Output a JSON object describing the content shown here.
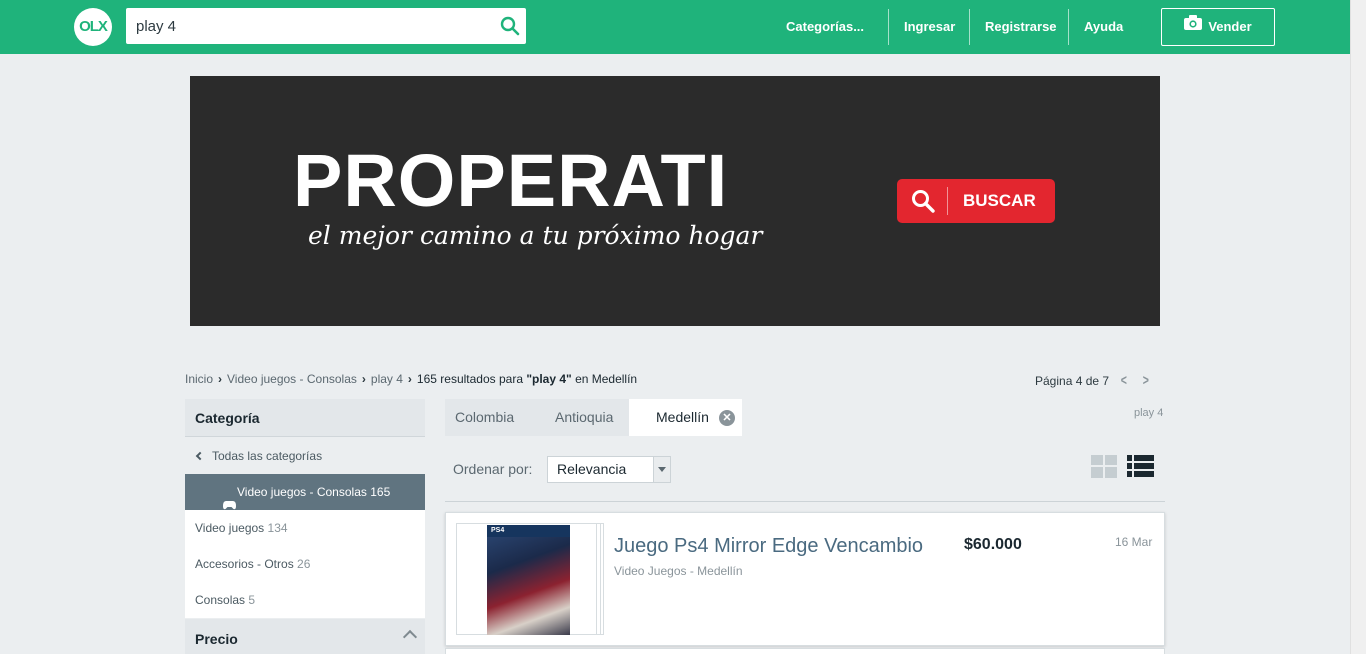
{
  "header": {
    "logo": "OLX",
    "search_value": "play 4",
    "nav": {
      "categories": "Categorías...",
      "login": "Ingresar",
      "register": "Registrarse",
      "help": "Ayuda",
      "sell": "Vender"
    },
    "brand_color": "#1fb37b"
  },
  "banner": {
    "title": "PROPERATI",
    "subtitle": "el mejor camino a tu próximo hogar",
    "button": "BUSCAR",
    "button_color": "#e3262f"
  },
  "breadcrumb": {
    "home": "Inicio",
    "category": "Video juegos - Consolas",
    "query": "play 4",
    "results_prefix": "165 resultados para ",
    "results_query": "\"play 4\"",
    "results_suffix": " en Medellín"
  },
  "pagination": {
    "text": "Página 4 de 7"
  },
  "sidebar": {
    "category_heading": "Categoría",
    "all_categories": "Todas las categorías",
    "active": {
      "label": "Video juegos - Consolas",
      "count": "165"
    },
    "items": [
      {
        "label": "Video juegos",
        "count": "134"
      },
      {
        "label": "Accesorios - Otros",
        "count": "26"
      },
      {
        "label": "Consolas",
        "count": "5"
      }
    ],
    "price_heading": "Precio"
  },
  "location_filter": {
    "country": "Colombia",
    "region": "Antioquia",
    "city": "Medellín",
    "tag": "play 4"
  },
  "sort": {
    "label": "Ordenar por:",
    "selected": "Relevancia"
  },
  "listings": [
    {
      "title": "Juego Ps4 Mirror Edge Vencambio",
      "subtitle": "Video Juegos - Medellín",
      "price": "$60.000",
      "date": "16 Mar",
      "thumb_label": "PS4"
    }
  ]
}
